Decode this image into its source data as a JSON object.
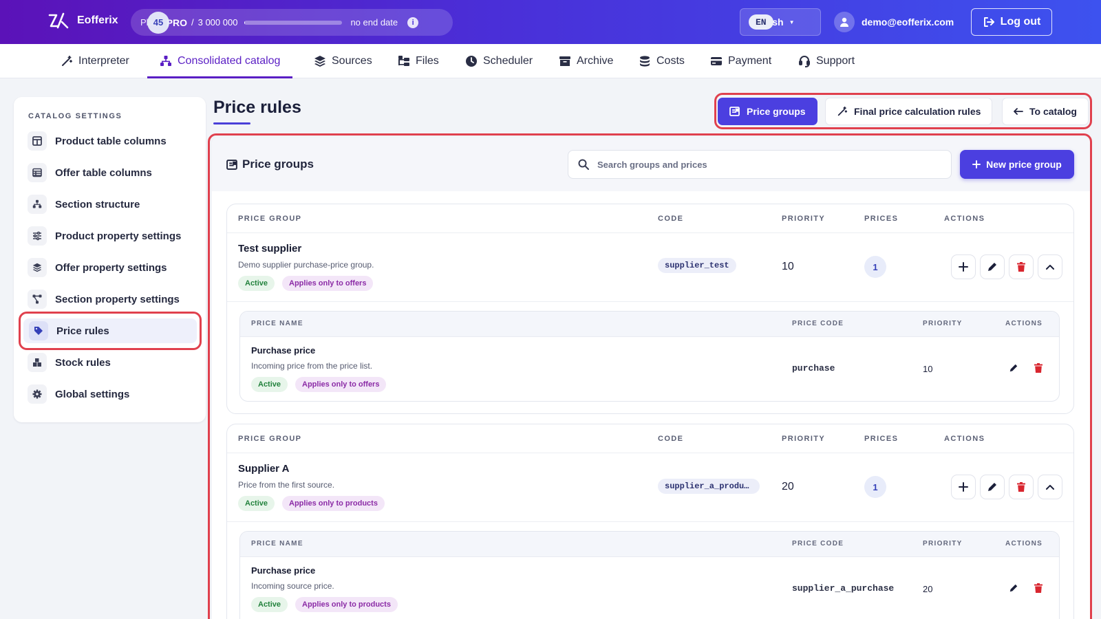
{
  "header": {
    "brand": "Eofferix",
    "plan": {
      "label": "Plan:",
      "tier": "PRO",
      "used": "45",
      "sep": "/",
      "limit": "3 000 000",
      "usage_fraction": 1.5e-05,
      "end": "no end date"
    },
    "language": {
      "code": "EN",
      "name": "English"
    },
    "user_email": "demo@eofferix.com",
    "logout_label": "Log out"
  },
  "nav": [
    {
      "label": "Interpreter",
      "icon": "magic-wand-icon"
    },
    {
      "label": "Consolidated catalog",
      "icon": "sitemap-icon",
      "active": true
    },
    {
      "label": "Sources",
      "icon": "layers-icon"
    },
    {
      "label": "Files",
      "icon": "folder-tree-icon"
    },
    {
      "label": "Scheduler",
      "icon": "clock-icon"
    },
    {
      "label": "Archive",
      "icon": "archive-icon"
    },
    {
      "label": "Costs",
      "icon": "coins-icon"
    },
    {
      "label": "Payment",
      "icon": "credit-card-icon"
    },
    {
      "label": "Support",
      "icon": "headset-icon"
    }
  ],
  "sidebar": {
    "title": "CATALOG SETTINGS",
    "items": [
      {
        "label": "Product table columns",
        "icon": "columns-icon"
      },
      {
        "label": "Offer table columns",
        "icon": "table-icon"
      },
      {
        "label": "Section structure",
        "icon": "sitemap-icon"
      },
      {
        "label": "Product property settings",
        "icon": "sliders-icon"
      },
      {
        "label": "Offer property settings",
        "icon": "layers-icon"
      },
      {
        "label": "Section property settings",
        "icon": "nodes-icon"
      },
      {
        "label": "Price rules",
        "icon": "tags-icon",
        "active": true
      },
      {
        "label": "Stock rules",
        "icon": "boxes-icon"
      },
      {
        "label": "Global settings",
        "icon": "gear-icon"
      }
    ]
  },
  "page": {
    "title": "Price rules",
    "tabs": {
      "price_groups": "Price groups",
      "final_rules": "Final price calculation rules",
      "to_catalog": "To catalog"
    }
  },
  "panel": {
    "title": "Price groups",
    "search_placeholder": "Search groups and prices",
    "new_button": "New price group",
    "group_headers": {
      "name": "PRICE GROUP",
      "code": "CODE",
      "priority": "PRIORITY",
      "prices": "PRICES",
      "actions": "ACTIONS"
    },
    "price_headers": {
      "name": "PRICE NAME",
      "code": "PRICE CODE",
      "priority": "PRIORITY",
      "actions": "ACTIONS"
    },
    "groups": [
      {
        "name": "Test supplier",
        "description": "Demo supplier purchase-price group.",
        "status": "Active",
        "scope": "Applies only to offers",
        "code": "supplier_test",
        "priority": "10",
        "prices_count": "1",
        "prices": [
          {
            "name": "Purchase price",
            "description": "Incoming price from the price list.",
            "status": "Active",
            "scope": "Applies only to offers",
            "code": "purchase",
            "priority": "10"
          }
        ]
      },
      {
        "name": "Supplier A",
        "description": "Price from the first source.",
        "status": "Active",
        "scope": "Applies only to products",
        "code": "supplier_a_produ…",
        "priority": "20",
        "prices_count": "1",
        "prices": [
          {
            "name": "Purchase price",
            "description": "Incoming source price.",
            "status": "Active",
            "scope": "Applies only to products",
            "code": "supplier_a_purchase",
            "priority": "20"
          }
        ]
      }
    ]
  },
  "colors": {
    "accent": "#4b3fe0",
    "nav_active": "#5a1ec4",
    "highlight": "#e0404d",
    "danger": "#d8262f"
  }
}
